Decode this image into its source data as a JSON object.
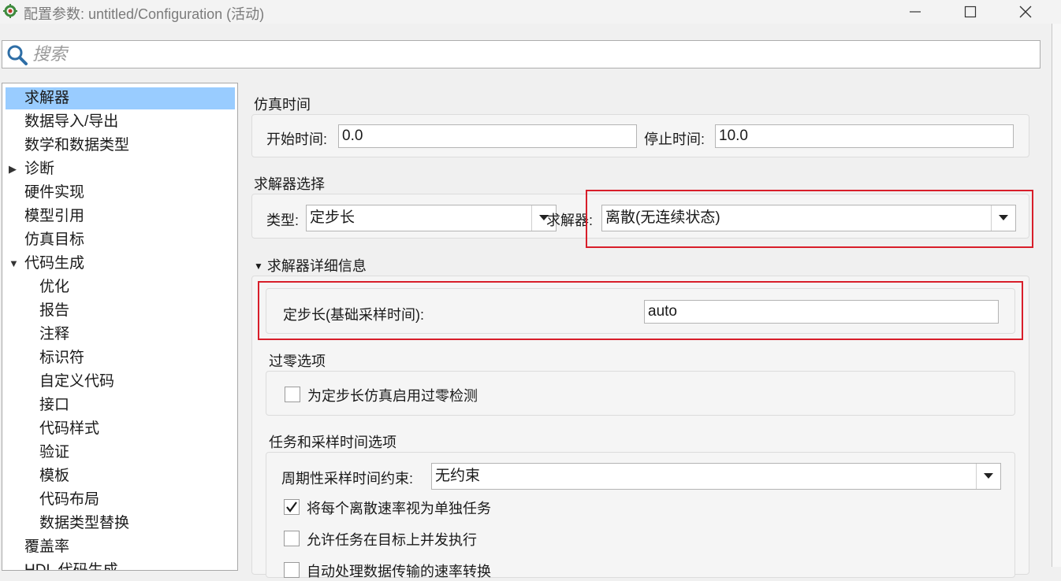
{
  "window": {
    "title": "配置参数: untitled/Configuration (活动)",
    "app_icon": "simulink-gear-icon",
    "controls": [
      "minimize-icon",
      "maximize-icon",
      "close-icon"
    ]
  },
  "search": {
    "placeholder": "搜索",
    "value": ""
  },
  "tree": {
    "items": [
      {
        "label": "求解器",
        "selected": true
      },
      {
        "label": "数据导入/导出"
      },
      {
        "label": "数学和数据类型"
      },
      {
        "label": "诊断",
        "expander": "collapsed"
      },
      {
        "label": "硬件实现"
      },
      {
        "label": "模型引用"
      },
      {
        "label": "仿真目标"
      },
      {
        "label": "代码生成",
        "expander": "expanded"
      },
      {
        "label": "优化"
      },
      {
        "label": "报告"
      },
      {
        "label": "注释"
      },
      {
        "label": "标识符"
      },
      {
        "label": "自定义代码"
      },
      {
        "label": "接口"
      },
      {
        "label": "代码样式"
      },
      {
        "label": "验证"
      },
      {
        "label": "模板"
      },
      {
        "label": "代码布局"
      },
      {
        "label": "数据类型替换"
      },
      {
        "label": "覆盖率"
      },
      {
        "label": "HDL 代码生成"
      }
    ]
  },
  "sim_time": {
    "section_label": "仿真时间",
    "start_label": "开始时间:",
    "start_value": "0.0",
    "stop_label": "停止时间:",
    "stop_value": "10.0"
  },
  "solver_selection": {
    "section_label": "求解器选择",
    "type_label": "类型:",
    "type_value": "定步长",
    "solver_label": "求解器:",
    "solver_value": "离散(无连续状态)"
  },
  "solver_details": {
    "section_label": "求解器详细信息",
    "fixed_step_label": "定步长(基础采样时间):",
    "fixed_step_value": "auto",
    "zero_crossing": {
      "section_label": "过零选项",
      "enable_label": "为定步长仿真启用过零检测",
      "enable_checked": false
    },
    "tasking": {
      "section_label": "任务和采样时间选项",
      "periodic_label": "周期性采样时间约束:",
      "periodic_value": "无约束",
      "each_rate_label": "将每个离散速率视为单独任务",
      "each_rate_checked": true,
      "concurrent_label": "允许任务在目标上并发执行",
      "concurrent_checked": false,
      "auto_rate_label": "自动处理数据传输的速率转换",
      "auto_rate_checked": false
    }
  },
  "colors": {
    "selection": "#99ccff",
    "highlight_box": "#d81e2a"
  }
}
